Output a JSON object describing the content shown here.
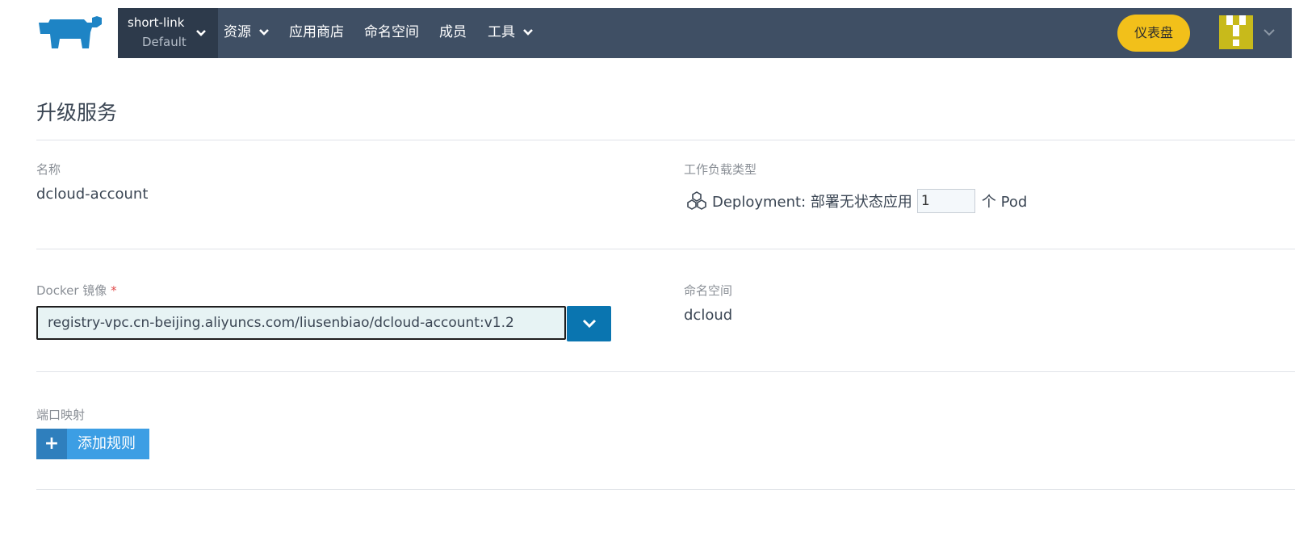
{
  "colors": {
    "navbar": "#3f4f64",
    "project_bg": "#2d3a4b",
    "dashboard_button": "#f2c01a",
    "primary_blue": "#0a75b0",
    "add_button": "#3c9ee4",
    "logo": "#1e84c5"
  },
  "header": {
    "logo_icon": "rancher-cow-icon",
    "project_name": "short-link",
    "cluster_name": "Default",
    "nav": [
      {
        "label": "资源",
        "has_dropdown": true
      },
      {
        "label": "应用商店",
        "has_dropdown": false
      },
      {
        "label": "命名空间",
        "has_dropdown": false
      },
      {
        "label": "成员",
        "has_dropdown": false
      },
      {
        "label": "工具",
        "has_dropdown": true
      }
    ],
    "dashboard_label": "仪表盘",
    "avatar_icon": "user-avatar-icon"
  },
  "page": {
    "title": "升级服务"
  },
  "form": {
    "name_label": "名称",
    "name_value": "dcloud-account",
    "workload_label": "工作负载类型",
    "workload_type": "Deployment: 部署无状态应用",
    "scale_value": "1",
    "scale_unit": "个 Pod",
    "image_label": "Docker 镜像",
    "required_mark": "*",
    "image_value": "registry-vpc.cn-beijing.aliyuncs.com/liusenbiao/dcloud-account:v1.2",
    "namespace_label": "命名空间",
    "namespace_value": "dcloud",
    "ports_label": "端口映射",
    "add_rule_label": "添加规则"
  }
}
